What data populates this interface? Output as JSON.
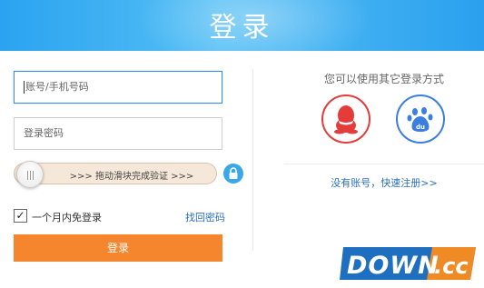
{
  "header": {
    "title": "登录"
  },
  "form": {
    "account_placeholder": "账号/手机号码",
    "password_placeholder": "登录密码",
    "slider_text": ">>> 拖动滑块完成验证 >>>",
    "remember_checked": true,
    "remember_label": "一个月内免登录",
    "forgot_label": "找回密码",
    "login_label": "登录"
  },
  "social": {
    "title": "您可以使用其它登录方式",
    "providers": [
      {
        "name": "qq-icon",
        "color": "#e43b3b"
      },
      {
        "name": "baidu-icon",
        "color": "#3a7ee0"
      }
    ],
    "register_label": "没有账号，快速注册>>"
  },
  "watermark": {
    "text": "DOWN.cc"
  },
  "colors": {
    "header": "#2aa3f0",
    "accent_orange": "#f5862d",
    "link_blue": "#2c6fb8",
    "qq_red": "#e43b3b",
    "baidu_blue": "#3a7ee0"
  }
}
